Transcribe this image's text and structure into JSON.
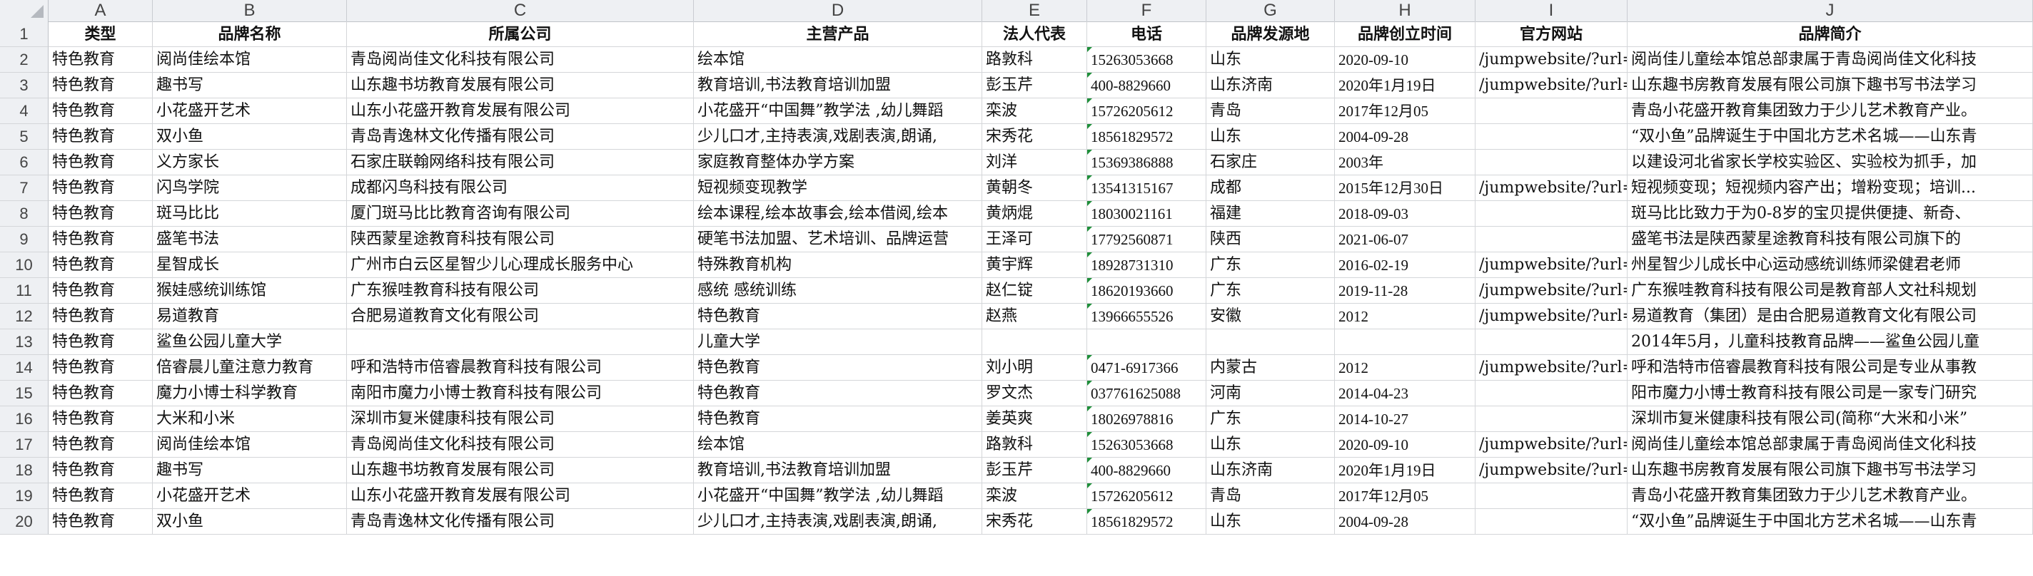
{
  "columns": [
    "A",
    "B",
    "C",
    "D",
    "E",
    "F",
    "G",
    "H",
    "I",
    "J"
  ],
  "header": [
    "类型",
    "品牌名称",
    "所属公司",
    "主营产品",
    "法人代表",
    "电话",
    "品牌发源地",
    "品牌创立时间",
    "官方网站",
    "品牌简介"
  ],
  "rows": [
    [
      "特色教育",
      "阅尚佳绘本馆",
      "青岛阅尚佳文化科技有限公司",
      "绘本馆",
      "路敦科",
      "15263053668",
      "山东",
      "2020-09-10",
      "/jumpwebsite/?url=",
      "阅尚佳儿童绘本馆总部隶属于青岛阅尚佳文化科技"
    ],
    [
      "特色教育",
      "趣书写",
      "山东趣书坊教育发展有限公司",
      "教育培训,书法教育培训加盟",
      "彭玉芹",
      "400-8829660",
      "山东济南",
      "2020年1月19日",
      "/jumpwebsite/?url=",
      "山东趣书房教育发展有限公司旗下趣书写书法学习"
    ],
    [
      "特色教育",
      "小花盛开艺术",
      "山东小花盛开教育发展有限公司",
      "小花盛开“中国舞”教学法 ,幼儿舞蹈",
      "栾波",
      "15726205612",
      "青岛",
      "2017年12月05",
      "",
      "青岛小花盛开教育集团致力于少儿艺术教育产业。"
    ],
    [
      "特色教育",
      "双小鱼",
      "青岛青逸林文化传播有限公司",
      "少儿口才,主持表演,戏剧表演,朗诵,",
      "宋秀花",
      "18561829572",
      "山东",
      "2004-09-28",
      "",
      "“双小鱼”品牌诞生于中国北方艺术名城——山东青"
    ],
    [
      "特色教育",
      "义方家长",
      "石家庄联翰网络科技有限公司",
      "家庭教育整体办学方案",
      "刘洋",
      "15369386888",
      "石家庄",
      "2003年",
      "",
      "以建设河北省家长学校实验区、实验校为抓手，加"
    ],
    [
      "特色教育",
      "闪鸟学院",
      "成都闪鸟科技有限公司",
      "短视频变现教学",
      "黄朝冬",
      "13541315167",
      "成都",
      "2015年12月30日",
      "/jumpwebsite/?url=",
      "短视频变现；短视频内容产出；增粉变现；培训..."
    ],
    [
      "特色教育",
      "斑马比比",
      "厦门斑马比比教育咨询有限公司",
      "绘本课程,绘本故事会,绘本借阅,绘本",
      "黄炳焜",
      "18030021161",
      "福建",
      "2018-09-03",
      "",
      "斑马比比致力于为0-8岁的宝贝提供便捷、新奇、"
    ],
    [
      "特色教育",
      "盛笔书法",
      "陕西蒙星途教育科技有限公司",
      "硬笔书法加盟、艺术培训、品牌运营",
      "王泽可",
      "17792560871",
      "陕西",
      "2021-06-07",
      "",
      "盛笔书法是陕西蒙星途教育科技有限公司旗下的"
    ],
    [
      "特色教育",
      "星智成长",
      "广州市白云区星智少儿心理成长服务中心",
      "特殊教育机构",
      "黄宇辉",
      "18928731310",
      "广东",
      "2016-02-19",
      "/jumpwebsite/?url=",
      "州星智少儿成长中心运动感统训练师梁健君老师"
    ],
    [
      "特色教育",
      "猴娃感统训练馆",
      "广东猴哇教育科技有限公司",
      "感统  感统训练",
      "赵仁锭",
      "18620193660",
      "广东",
      "2019-11-28",
      "/jumpwebsite/?url=",
      "广东猴哇教育科技有限公司是教育部人文社科规划"
    ],
    [
      "特色教育",
      "易道教育",
      "合肥易道教育文化有限公司",
      "特色教育",
      "赵燕",
      "13966655526",
      "安徽",
      "2012",
      "/jumpwebsite/?url=",
      "易道教育（集团）是由合肥易道教育文化有限公司"
    ],
    [
      "特色教育",
      "鲨鱼公园儿童大学",
      "",
      "儿童大学",
      "",
      "",
      "",
      "",
      "",
      "2014年5月，儿童科技教育品牌——鲨鱼公园儿童"
    ],
    [
      "特色教育",
      "倍睿晨儿童注意力教育",
      "呼和浩特市倍睿晨教育科技有限公司",
      "特色教育",
      "刘小明",
      "0471-6917366",
      "内蒙古",
      "2012",
      "/jumpwebsite/?url=",
      "呼和浩特市倍睿晨教育科技有限公司是专业从事教"
    ],
    [
      "特色教育",
      "魔力小博士科学教育",
      "南阳市魔力小博士教育科技有限公司",
      "特色教育",
      "罗文杰",
      "037761625088",
      "河南",
      "2014-04-23",
      "",
      "阳市魔力小博士教育科技有限公司是一家专门研究"
    ],
    [
      "特色教育",
      "大米和小米",
      "深圳市复米健康科技有限公司",
      "特色教育",
      "姜英爽",
      "18026978816",
      "广东",
      "2014-10-27",
      "",
      "深圳市复米健康科技有限公司(简称“大米和小米”"
    ],
    [
      "特色教育",
      "阅尚佳绘本馆",
      "青岛阅尚佳文化科技有限公司",
      "绘本馆",
      "路敦科",
      "15263053668",
      "山东",
      "2020-09-10",
      "/jumpwebsite/?url=",
      "阅尚佳儿童绘本馆总部隶属于青岛阅尚佳文化科技"
    ],
    [
      "特色教育",
      "趣书写",
      "山东趣书坊教育发展有限公司",
      "教育培训,书法教育培训加盟",
      "彭玉芹",
      "400-8829660",
      "山东济南",
      "2020年1月19日",
      "/jumpwebsite/?url=",
      "山东趣书房教育发展有限公司旗下趣书写书法学习"
    ],
    [
      "特色教育",
      "小花盛开艺术",
      "山东小花盛开教育发展有限公司",
      "小花盛开“中国舞”教学法 ,幼儿舞蹈",
      "栾波",
      "15726205612",
      "青岛",
      "2017年12月05",
      "",
      "青岛小花盛开教育集团致力于少儿艺术教育产业。"
    ],
    [
      "特色教育",
      "双小鱼",
      "青岛青逸林文化传播有限公司",
      "少儿口才,主持表演,戏剧表演,朗诵,",
      "宋秀花",
      "18561829572",
      "山东",
      "2004-09-28",
      "",
      "“双小鱼”品牌诞生于中国北方艺术名城——山东青"
    ]
  ]
}
